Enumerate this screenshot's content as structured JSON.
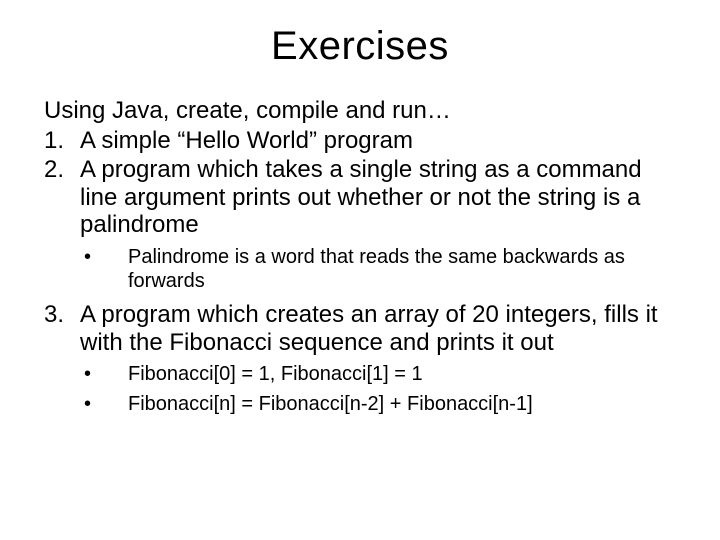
{
  "title": "Exercises",
  "intro": "Using Java, create, compile and run…",
  "items": [
    {
      "num": "1.",
      "text": "A simple “Hello World” program",
      "subs": []
    },
    {
      "num": "2.",
      "text": "A program which takes a single string as a command line argument prints out whether or not the string is a palindrome",
      "subs": [
        "Palindrome is a word that reads the same backwards as forwards"
      ]
    },
    {
      "num": "3.",
      "text": "A program which creates an array of 20 integers, fills it with the Fibonacci sequence and prints it out",
      "subs": [
        "Fibonacci[0] = 1, Fibonacci[1] = 1",
        "Fibonacci[n] = Fibonacci[n-2] + Fibonacci[n-1]"
      ]
    }
  ]
}
